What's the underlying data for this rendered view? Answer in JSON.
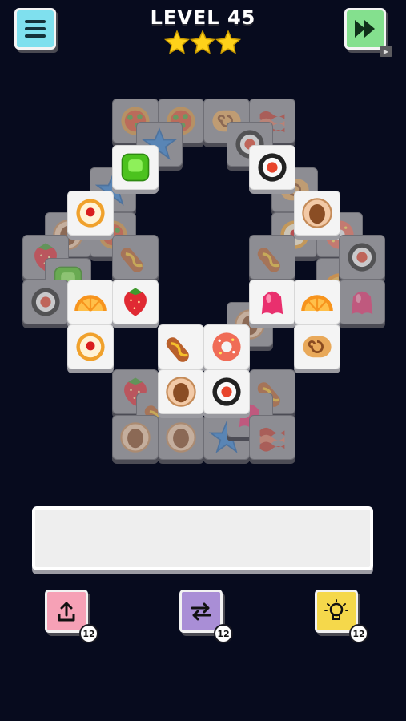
{
  "header": {
    "level_label": "LEVEL 45",
    "stars": 3,
    "menu_icon": "hamburger-menu-icon",
    "skip_icon": "fast-forward-icon",
    "ad_badge": "▶"
  },
  "colors": {
    "background": "#070b1e",
    "menu_button": "#7fe0ee",
    "skip_button": "#84e08e",
    "undo_button": "#f6a1b6",
    "shuffle_button": "#a98ed6",
    "hint_button": "#f5d84b",
    "star": "#ffd21a"
  },
  "board": {
    "tiles": [
      {
        "icon": "pizza",
        "state": "locked"
      },
      {
        "icon": "pizza",
        "state": "locked"
      },
      {
        "icon": "swiss-roll",
        "state": "locked"
      },
      {
        "icon": "bacon",
        "state": "locked"
      },
      {
        "icon": "star-candy",
        "state": "locked"
      },
      {
        "icon": "sushi",
        "state": "locked"
      },
      {
        "icon": "jelly-cube",
        "state": "free"
      },
      {
        "icon": "sushi",
        "state": "free"
      },
      {
        "icon": "star-candy",
        "state": "locked"
      },
      {
        "icon": "egg-tart",
        "state": "free"
      },
      {
        "icon": "swiss-roll",
        "state": "locked"
      },
      {
        "icon": "cookie",
        "state": "free"
      },
      {
        "icon": "cookie",
        "state": "locked"
      },
      {
        "icon": "pizza",
        "state": "locked"
      },
      {
        "icon": "egg-tart",
        "state": "locked"
      },
      {
        "icon": "donut",
        "state": "locked"
      },
      {
        "icon": "strawberry",
        "state": "locked"
      },
      {
        "icon": "jelly-cube",
        "state": "locked"
      },
      {
        "icon": "sausage",
        "state": "locked"
      },
      {
        "icon": "sausage",
        "state": "locked"
      },
      {
        "icon": "orange-slice",
        "state": "locked"
      },
      {
        "icon": "sushi",
        "state": "locked"
      },
      {
        "icon": "sushi",
        "state": "locked"
      },
      {
        "icon": "jelly",
        "state": "locked"
      },
      {
        "icon": "orange-slice",
        "state": "free"
      },
      {
        "icon": "strawberry",
        "state": "free"
      },
      {
        "icon": "jelly",
        "state": "free"
      },
      {
        "icon": "orange-slice",
        "state": "free"
      },
      {
        "icon": "egg-tart",
        "state": "free"
      },
      {
        "icon": "cookie",
        "state": "locked"
      },
      {
        "icon": "sausage",
        "state": "free"
      },
      {
        "icon": "donut",
        "state": "free"
      },
      {
        "icon": "swiss-roll",
        "state": "free"
      },
      {
        "icon": "strawberry",
        "state": "locked"
      },
      {
        "icon": "sausage",
        "state": "locked"
      },
      {
        "icon": "cookie",
        "state": "free"
      },
      {
        "icon": "sushi",
        "state": "free"
      },
      {
        "icon": "sausage",
        "state": "locked"
      },
      {
        "icon": "cookie",
        "state": "locked"
      },
      {
        "icon": "cookie",
        "state": "locked"
      },
      {
        "icon": "star-candy",
        "state": "locked"
      },
      {
        "icon": "jelly",
        "state": "locked"
      },
      {
        "icon": "bacon",
        "state": "locked"
      }
    ]
  },
  "tray": {
    "slots_filled": 0
  },
  "tools": [
    {
      "name": "undo",
      "icon": "undo-arrow-icon",
      "count": "12"
    },
    {
      "name": "shuffle",
      "icon": "shuffle-icon",
      "count": "12"
    },
    {
      "name": "hint",
      "icon": "lightbulb-icon",
      "count": "12"
    }
  ]
}
